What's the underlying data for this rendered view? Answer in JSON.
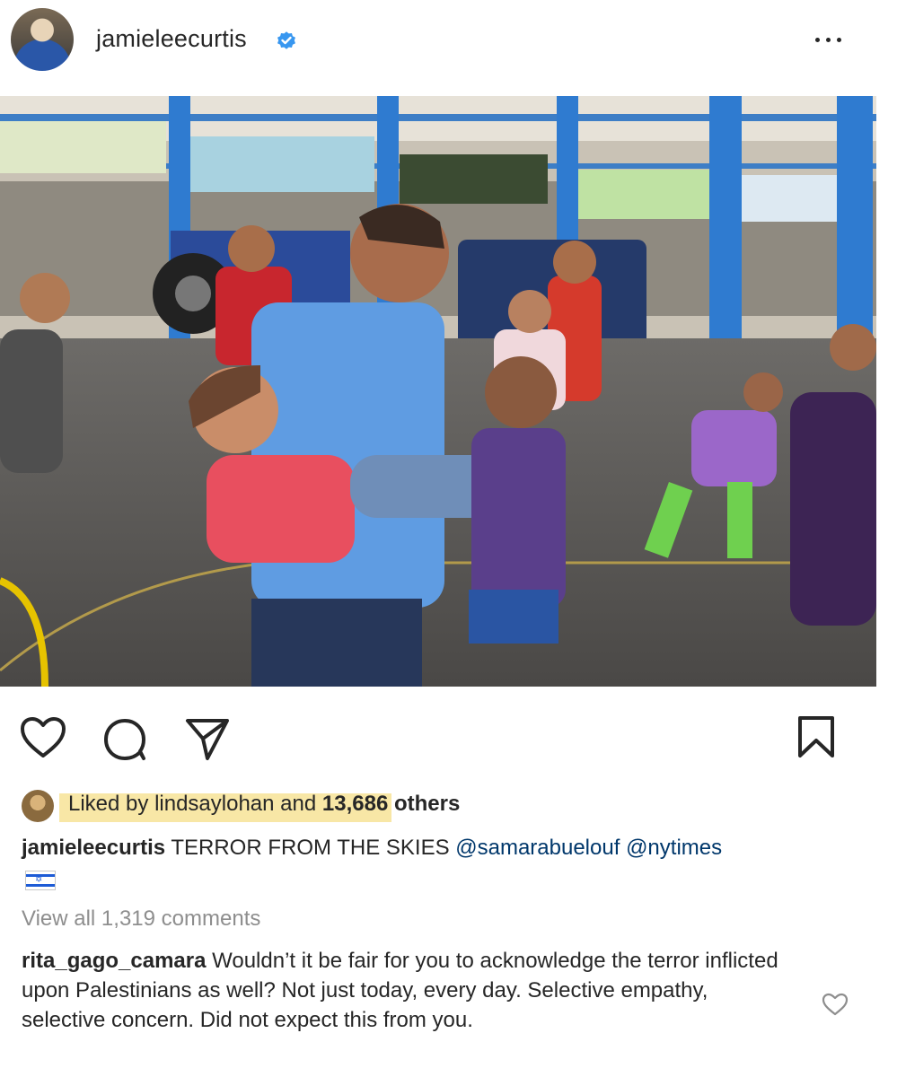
{
  "post": {
    "username": "jamieleecurtis",
    "verified": true
  },
  "icons": {
    "more": "more-options-icon",
    "like": "heart-icon",
    "comment": "comment-bubble-icon",
    "share": "paper-plane-icon",
    "save": "bookmark-icon",
    "flag": "israel-flag-emoji"
  },
  "likes": {
    "prefix": "Liked by ",
    "user": "lindsaylohan",
    "middle": " and ",
    "others": "13,686 others"
  },
  "caption": {
    "user": "jamieleecurtis",
    "text": " TERROR FROM THE SKIES ",
    "mention1": "@samarabuelouf",
    "mention2": "@nytimes"
  },
  "comments": {
    "view_all": "View all 1,319 comments",
    "items": [
      {
        "user": "rita_gago_camara",
        "text": " Wouldn’t it be fair for you to acknowledge the terror inflicted upon Palestinians as well? Not just today, every day. Selective empathy, selective concern. Did not expect this from you."
      }
    ]
  },
  "colors": {
    "verified": "#3897f0",
    "highlight": "#f8e7a6",
    "mention": "#00376b",
    "muted": "#8e8e8e"
  }
}
